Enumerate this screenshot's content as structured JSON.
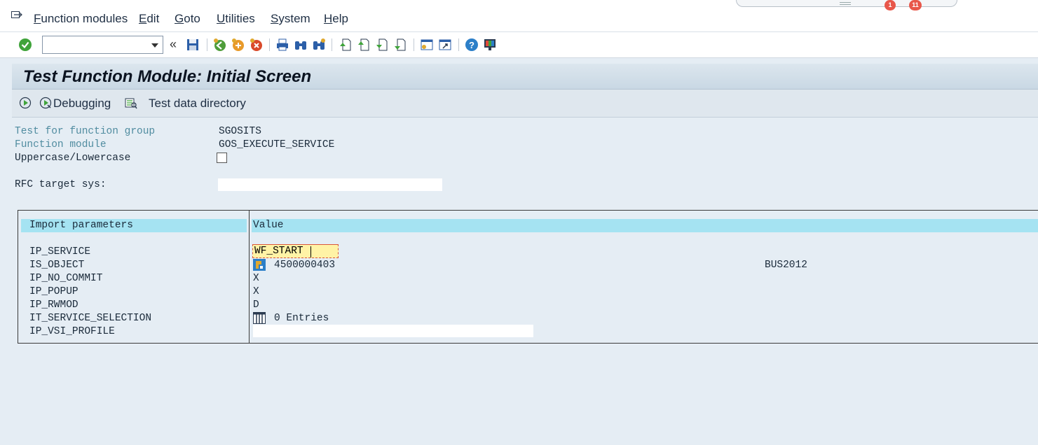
{
  "menubar": {
    "items": [
      {
        "pre": "",
        "ul": "F",
        "post": "unction modules"
      },
      {
        "pre": "",
        "ul": "E",
        "post": "dit"
      },
      {
        "pre": "",
        "ul": "G",
        "post": "oto"
      },
      {
        "pre": "",
        "ul": "U",
        "post": "tilities"
      },
      {
        "pre": "",
        "ul": "S",
        "post": "ystem"
      },
      {
        "pre": "",
        "ul": "H",
        "post": "elp"
      }
    ],
    "badges": [
      "1",
      "11"
    ]
  },
  "toolbar": {
    "command_value": "",
    "icons": [
      "enter-icon",
      "save-icon",
      "back-icon",
      "exit-icon",
      "cancel-icon",
      "print-icon",
      "find-icon",
      "find-next-icon",
      "first-page-icon",
      "previous-page-icon",
      "next-page-icon",
      "last-page-icon",
      "new-session-icon",
      "shortcut-icon",
      "help-icon",
      "customize-layout-icon"
    ]
  },
  "title": "Test Function Module: Initial Screen",
  "app_toolbar": {
    "debugging_label": "Debugging",
    "test_data_label": "Test data directory"
  },
  "form": {
    "function_group_label": "Test for function group",
    "function_group_value": "SGOSITS",
    "function_module_label": "Function module",
    "function_module_value": "GOS_EXECUTE_SERVICE",
    "case_label": "Uppercase/Lowercase",
    "case_checked": false,
    "rfc_label": "RFC target sys:",
    "rfc_value": ""
  },
  "params": {
    "header_name": "Import parameters",
    "header_value": "Value",
    "rows": [
      {
        "name": "IP_SERVICE",
        "value": "WF_START"
      },
      {
        "name": "IS_OBJECT",
        "value": "4500000403",
        "extra": "BUS2012"
      },
      {
        "name": "IP_NO_COMMIT",
        "value": "X"
      },
      {
        "name": "IP_POPUP",
        "value": "X"
      },
      {
        "name": "IP_RWMOD",
        "value": "D"
      },
      {
        "name": "IT_SERVICE_SELECTION",
        "value": "0 Entries"
      },
      {
        "name": "IP_VSI_PROFILE",
        "value": ""
      }
    ]
  },
  "colors": {
    "header_cyan": "#a5e3f2",
    "field_yellow": "#fff3a6",
    "label_teal": "#508ca0",
    "background": "#e5edf4"
  }
}
